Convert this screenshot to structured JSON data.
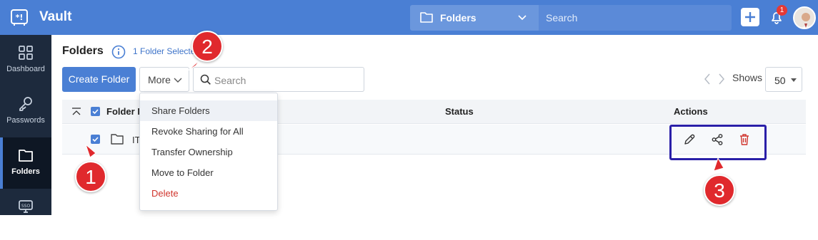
{
  "app": {
    "title": "Vault"
  },
  "topbar": {
    "folder_selector": "Folders",
    "search_placeholder": "Search",
    "notification_count": "1"
  },
  "sidebar": {
    "items": [
      {
        "label": "Dashboard",
        "icon": "grid-icon"
      },
      {
        "label": "Passwords",
        "icon": "key-icon"
      },
      {
        "label": "Folders",
        "icon": "folder-icon",
        "active": true
      },
      {
        "label": "",
        "icon": "sso-monitor-icon"
      }
    ]
  },
  "main": {
    "title": "Folders",
    "selected_text": "1 Folder Selecte",
    "create_button": "Create Folder",
    "more_button": "More",
    "search_placeholder": "Search",
    "shows_label": "Shows",
    "per_page": "50"
  },
  "table": {
    "columns": [
      "Folder I",
      "Status",
      "Actions"
    ],
    "rows": [
      {
        "name": "IT",
        "checked": true
      }
    ]
  },
  "more_menu": {
    "items": [
      {
        "label": "Share Folders",
        "highlighted": true
      },
      {
        "label": "Revoke Sharing for All"
      },
      {
        "label": "Transfer Ownership"
      },
      {
        "label": "Move to Folder"
      },
      {
        "label": "Delete",
        "danger": true
      }
    ]
  },
  "callouts": [
    "1",
    "2",
    "3"
  ],
  "colors": {
    "topbar": "#4a7fd4",
    "sidebar": "#1d2a3d",
    "callout": "#e0292d",
    "highlight_box": "#2a1fa8",
    "danger": "#d0342c"
  }
}
